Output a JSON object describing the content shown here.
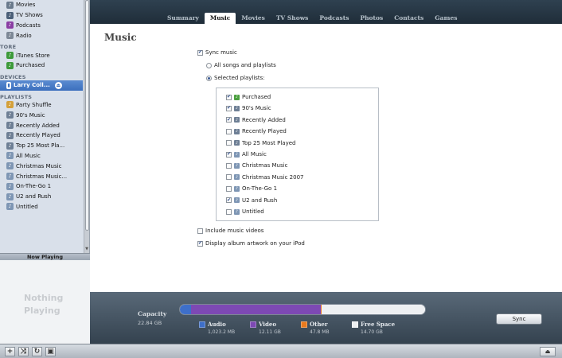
{
  "sidebar": {
    "top_items": [
      {
        "label": "Movies",
        "icon": "movies-icon",
        "color": "#6a7a8c"
      },
      {
        "label": "TV Shows",
        "icon": "tv-icon",
        "color": "#4b5f78"
      },
      {
        "label": "Podcasts",
        "icon": "podcast-icon",
        "color": "#8a3ea3"
      },
      {
        "label": "Radio",
        "icon": "radio-icon",
        "color": "#7d8896"
      }
    ],
    "store_head": "TORE",
    "store_items": [
      {
        "label": "iTunes Store",
        "icon": "store-icon",
        "color": "#3d9a3a"
      },
      {
        "label": "Purchased",
        "icon": "purchased-icon",
        "color": "#3d9a3a"
      }
    ],
    "devices_head": "DEVICES",
    "device": {
      "label": "Larry Coll...",
      "eject": "⏏"
    },
    "playlists_head": "PLAYLISTS",
    "playlists": [
      {
        "label": "Party Shuffle",
        "icon": "party-shuffle-icon",
        "color": "#d4a03a"
      },
      {
        "label": "90's Music",
        "icon": "smart-playlist-icon",
        "color": "#6e7f95"
      },
      {
        "label": "Recently Added",
        "icon": "smart-playlist-icon",
        "color": "#6e7f95"
      },
      {
        "label": "Recently Played",
        "icon": "smart-playlist-icon",
        "color": "#6e7f95"
      },
      {
        "label": "Top 25 Most Pla...",
        "icon": "smart-playlist-icon",
        "color": "#6e7f95"
      },
      {
        "label": "All Music",
        "icon": "playlist-icon",
        "color": "#7e96b4"
      },
      {
        "label": "Christmas Music",
        "icon": "playlist-icon",
        "color": "#7e96b4"
      },
      {
        "label": "Christmas Music...",
        "icon": "playlist-icon",
        "color": "#7e96b4"
      },
      {
        "label": "On-The-Go 1",
        "icon": "playlist-icon",
        "color": "#7e96b4"
      },
      {
        "label": "U2 and Rush",
        "icon": "playlist-icon",
        "color": "#7e96b4"
      },
      {
        "label": "Untitled",
        "icon": "playlist-icon",
        "color": "#7e96b4"
      }
    ],
    "now_playing_label": "Now Playing",
    "nothing_playing": "Nothing Playing"
  },
  "tabs": [
    "Summary",
    "Music",
    "Movies",
    "TV Shows",
    "Podcasts",
    "Photos",
    "Contacts",
    "Games"
  ],
  "active_tab": "Music",
  "main": {
    "title": "Music",
    "sync_music": {
      "label": "Sync music",
      "checked": true
    },
    "all_songs": {
      "label": "All songs and playlists",
      "selected": false
    },
    "selected_playlists": {
      "label": "Selected playlists:",
      "selected": true
    },
    "playlists": [
      {
        "label": "Purchased",
        "checked": true,
        "type": "purchased"
      },
      {
        "label": "90's Music",
        "checked": true,
        "type": "smart"
      },
      {
        "label": "Recently Added",
        "checked": true,
        "type": "smart"
      },
      {
        "label": "Recently Played",
        "checked": false,
        "type": "smart"
      },
      {
        "label": "Top 25 Most Played",
        "checked": false,
        "type": "smart"
      },
      {
        "label": "All Music",
        "checked": true,
        "type": "normal"
      },
      {
        "label": "Christmas Music",
        "checked": false,
        "type": "normal"
      },
      {
        "label": "Christmas Music 2007",
        "checked": false,
        "type": "normal"
      },
      {
        "label": "On-The-Go 1",
        "checked": false,
        "type": "normal"
      },
      {
        "label": "U2 and Rush",
        "checked": true,
        "type": "normal"
      },
      {
        "label": "Untitled",
        "checked": false,
        "type": "normal"
      }
    ],
    "include_videos": {
      "label": "Include music videos",
      "checked": false
    },
    "display_artwork": {
      "label": "Display album artwork on your iPod",
      "checked": true
    }
  },
  "capacity": {
    "label": "Capacity",
    "total": "22.84 GB",
    "segments": [
      {
        "name": "Audio",
        "size": "1,023.2 MB",
        "color": "#3e6fc9",
        "fraction": 0.045
      },
      {
        "name": "Video",
        "size": "12.11 GB",
        "color": "#7d49b4",
        "fraction": 0.53
      },
      {
        "name": "Other",
        "size": "47.8 MB",
        "color": "#e97a1e",
        "fraction": 0.002
      },
      {
        "name": "Free Space",
        "size": "14.70 GB",
        "color": "#eef0f2",
        "fraction": 0.423
      }
    ],
    "sync_label": "Sync"
  },
  "bottom": {
    "add": "+",
    "shuffle": "⤨",
    "repeat": "↻",
    "artwork": "▣",
    "right": "⏏"
  }
}
